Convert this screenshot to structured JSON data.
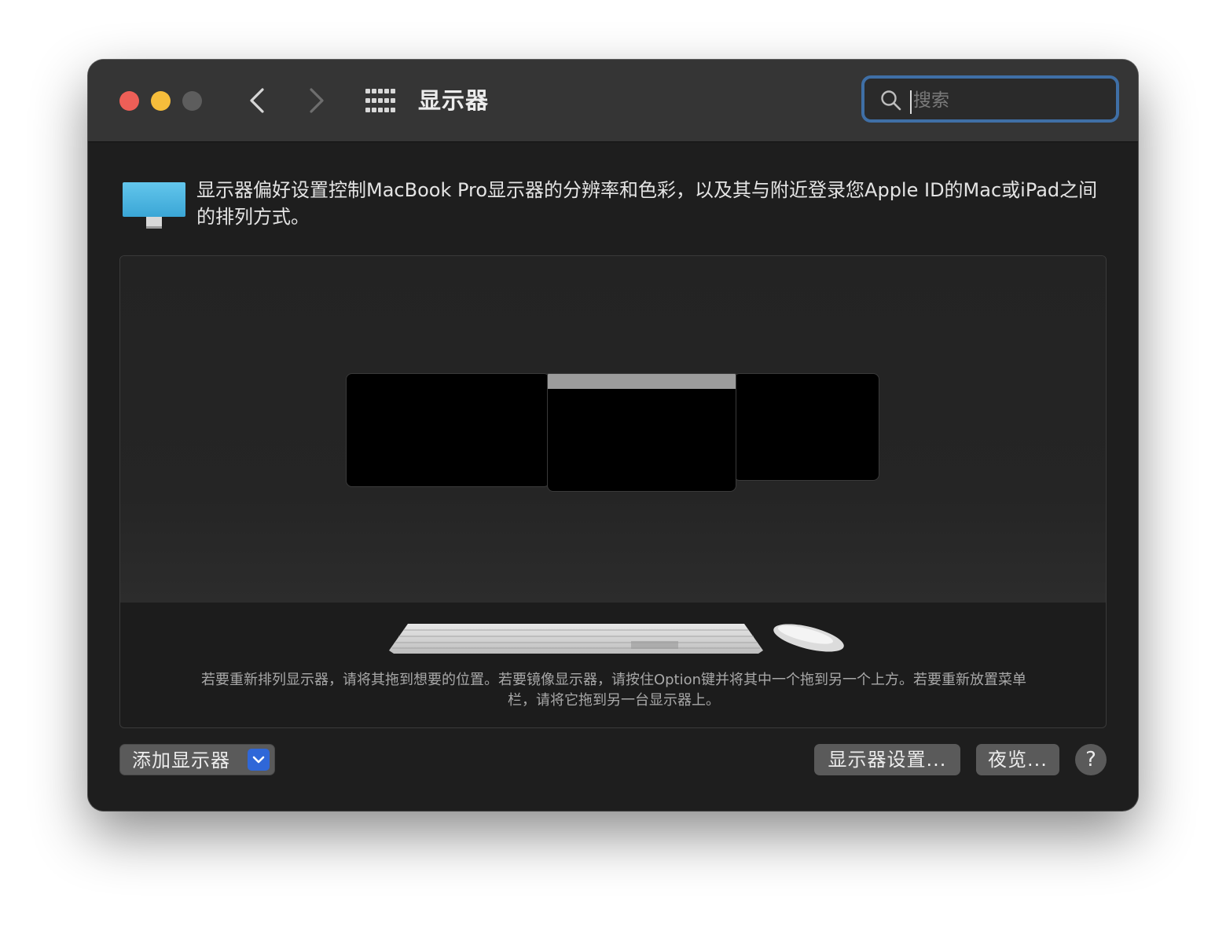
{
  "window": {
    "title": "显示器",
    "search": {
      "placeholder": "搜索",
      "value": ""
    }
  },
  "description": "显示器偏好设置控制MacBook Pro显示器的分辨率和色彩，以及其与附近登录您Apple ID的Mac或iPad之间的排列方式。",
  "arrangement": {
    "hint": "若要重新排列显示器，请将其拖到想要的位置。若要镜像显示器，请按住Option键并将其中一个拖到另一个上方。若要重新放置菜单栏，请将它拖到另一台显示器上。"
  },
  "footer": {
    "add_display_label": "添加显示器",
    "display_settings_label": "显示器设置...",
    "night_shift_label": "夜览...",
    "help_label": "?"
  },
  "colors": {
    "traffic_red": "#ee5f57",
    "traffic_yellow": "#f6bd3b",
    "search_focus_ring": "#3f6fa6",
    "monitor_icon": "#4cb6e0",
    "dropdown_accent": "#2f67d8"
  },
  "icons": [
    "back-arrow-icon",
    "forward-arrow-icon",
    "show-all-grid-icon",
    "search-icon",
    "monitor-icon",
    "chevron-down-icon",
    "keyboard-icon",
    "mouse-icon"
  ]
}
